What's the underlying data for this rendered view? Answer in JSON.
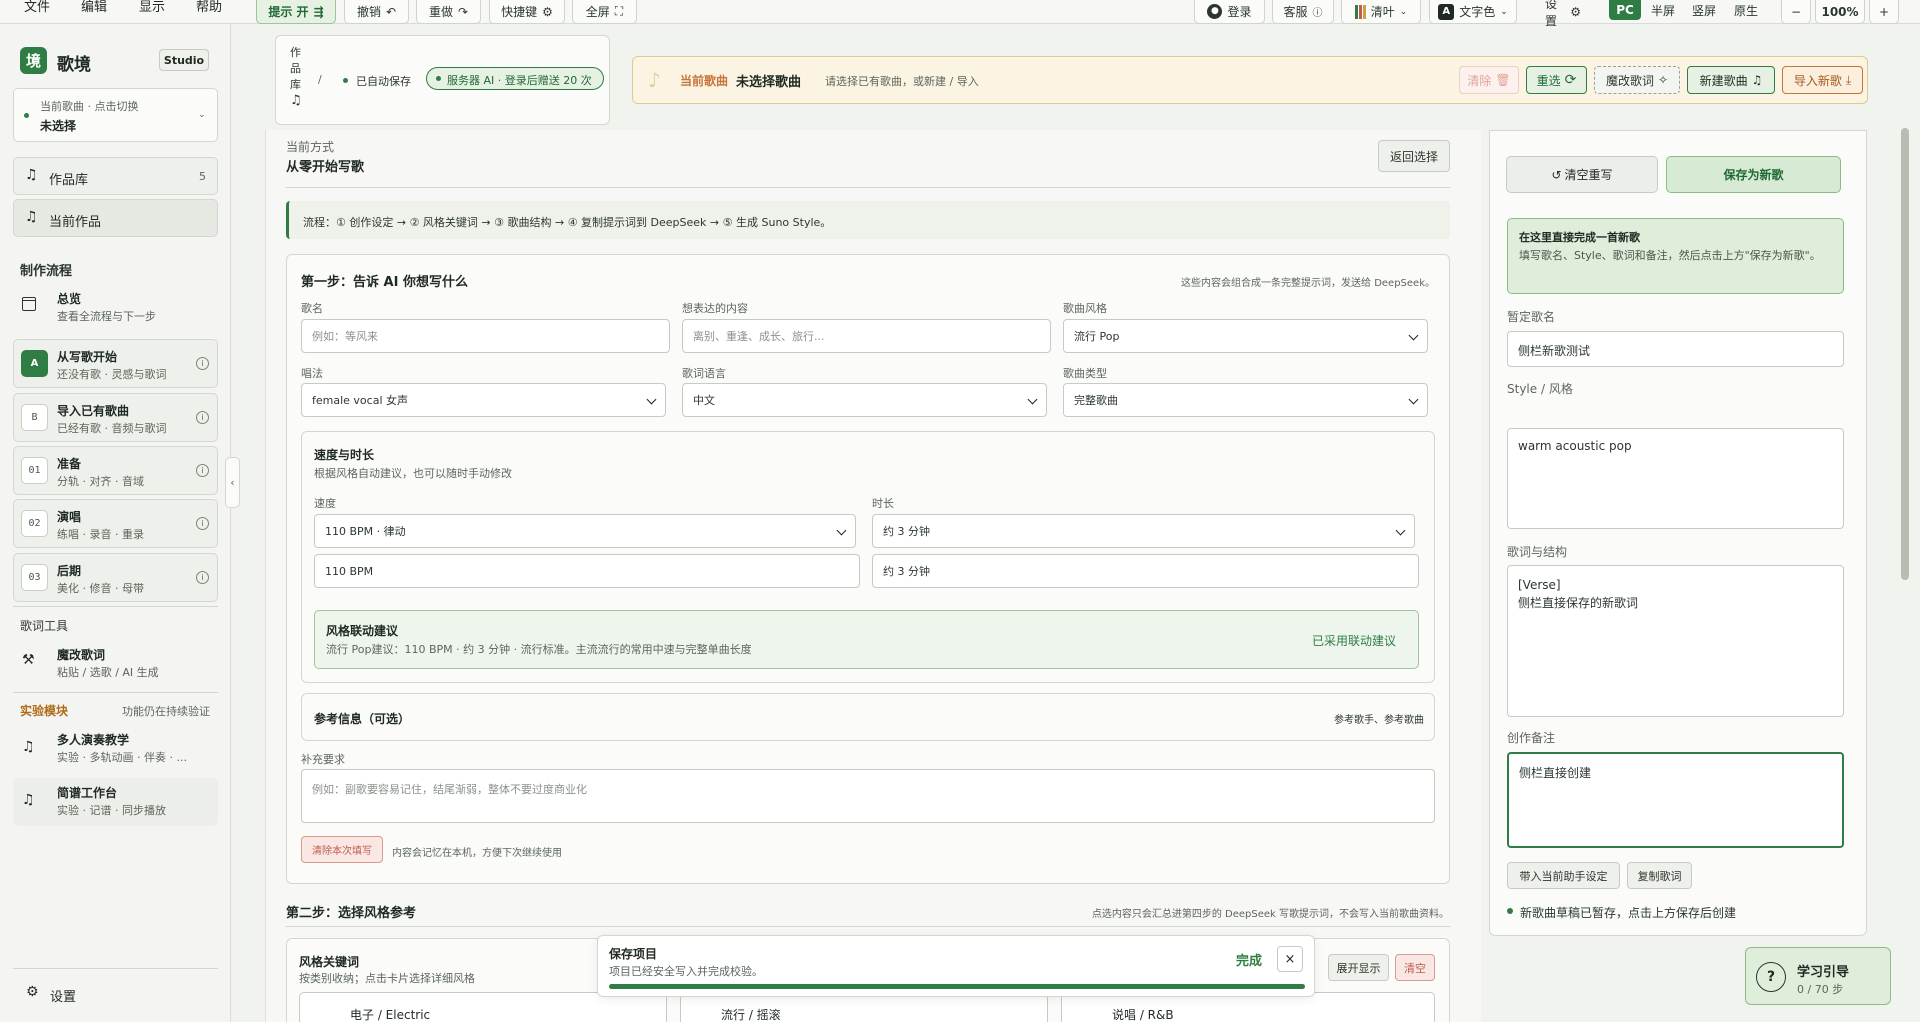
{
  "colors": {
    "accent": "#2f7d44",
    "accent_light": "#e6f1e4",
    "warn": "#c8743a",
    "danger": "#c45a4e",
    "banner_bg": "#fbf4e3"
  },
  "menubar": {
    "file": "文件",
    "edit": "编辑",
    "view": "显示",
    "help": "帮助"
  },
  "toolbar": {
    "hint": "提示 开",
    "undo": "撤销",
    "redo": "重做",
    "shortcut": "快捷键",
    "fullscreen": "全屏",
    "login": "登录",
    "support": "客服",
    "theme": "清叶",
    "text_color": "文字色",
    "settings": "设置",
    "layout_modes": [
      "PC",
      "半屏",
      "竖屏",
      "原生"
    ],
    "zoom_out": "−",
    "zoom": "100%",
    "zoom_in": "+"
  },
  "sidebar": {
    "brand": "歌境",
    "brand_logo": "境",
    "studio": "Studio",
    "current_song_hint": "当前歌曲 · 点击切换",
    "current_song_value": "未选择",
    "library": "作品库",
    "library_count": "5",
    "current_work": "当前作品",
    "workflow_heading": "制作流程",
    "overview_title": "总览",
    "overview_sub": "查看全流程与下一步",
    "steps": [
      {
        "badge": "A",
        "title": "从写歌开始",
        "sub": "还没有歌 · 灵感与歌词"
      },
      {
        "badge": "B",
        "title": "导入已有歌曲",
        "sub": "已经有歌 · 音频与歌词"
      },
      {
        "badge": "01",
        "title": "准备",
        "sub": "分轨 · 对齐 · 音域"
      },
      {
        "badge": "02",
        "title": "演唱",
        "sub": "练唱 · 录音 · 重录"
      },
      {
        "badge": "03",
        "title": "后期",
        "sub": "美化 · 修音 · 母带"
      }
    ],
    "lyric_tools_heading": "歌词工具",
    "lyric_edit_title": "魔改歌词",
    "lyric_edit_sub": "粘贴 / 选歌 / AI 生成",
    "lab_heading": "实验模块",
    "lab_note": "功能仍在持续验证",
    "lab_items": [
      {
        "title": "多人演奏教学",
        "sub": "实验 · 多轨动画 · 伴奏 · ..."
      },
      {
        "title": "简谱工作台",
        "sub": "实验 · 记谱 · 同步播放"
      }
    ],
    "settings": "设置"
  },
  "header_card": {
    "breadcrumb_chars": [
      "作",
      "品",
      "库"
    ],
    "separator": "/",
    "autosave": "已自动保存",
    "server": "服务器 AI · 登录后赠送 20 次"
  },
  "banner": {
    "label": "当前歌曲",
    "value": "未选择歌曲",
    "hint": "请选择已有歌曲，或新建 / 导入",
    "clear": "清除",
    "reselect": "重选",
    "edit_lyrics": "魔改歌词",
    "new_song": "新建歌曲",
    "import_new": "导入新歌"
  },
  "main": {
    "mode_label": "当前方式",
    "mode_value": "从零开始写歌",
    "back": "返回选择",
    "flow": "流程：① 创作设定 → ② 风格关键词 → ③ 歌曲结构 → ④ 复制提示词到 DeepSeek → ⑤ 生成 Suno Style。",
    "step1_title": "第一步：告诉 AI 你想写什么",
    "step1_note": "这些内容会组合成一条完整提示词，发送给 DeepSeek。",
    "song_name_label": "歌名",
    "song_name_ph": "例如：等风来",
    "content_label": "想表达的内容",
    "content_ph": "离别、重逢、成长、旅行...",
    "style_label": "歌曲风格",
    "style_value": "流行 Pop",
    "vocal_label": "唱法",
    "vocal_value": "female vocal 女声",
    "lang_label": "歌词语言",
    "lang_value": "中文",
    "type_label": "歌曲类型",
    "type_value": "完整歌曲",
    "tempo_title": "速度与时长",
    "tempo_sub": "根据风格自动建议，也可以随时手动修改",
    "speed_label": "速度",
    "speed_select": "110 BPM · 律动",
    "speed_value": "110 BPM",
    "duration_label": "时长",
    "duration_select": "约 3 分钟",
    "duration_value": "约 3 分钟",
    "suggest_title": "风格联动建议",
    "suggest_text": "流行 Pop建议：110 BPM · 约 3 分钟 · 流行标准。主流流行的常用中速与完整单曲长度",
    "suggest_status": "已采用联动建议",
    "ref_title": "参考信息（可选）",
    "ref_note": "参考歌手、参考歌曲",
    "extra_label": "补充要求",
    "extra_ph": "例如：副歌要容易记住，结尾渐弱，整体不要过度商业化",
    "clear_btn": "清除本次填写",
    "clear_note": "内容会记忆在本机，方便下次继续使用",
    "step2_title": "第二步：选择风格参考",
    "step2_note": "点选内容只会汇总进第四步的 DeepSeek 写歌提示词，不会写入当前歌曲资料。",
    "kw_title": "风格关键词",
    "kw_sub": "按类别收纳；点击卡片选择详细风格",
    "expand": "展开显示",
    "clear_kw": "清空",
    "genres": [
      "电子 / Electric",
      "流行 / 摇滚",
      "说唱 / R&B"
    ]
  },
  "right": {
    "reset": "清空重写",
    "save_new": "保存为新歌",
    "info_title": "在这里直接完成一首新歌",
    "info_text": "填写歌名、Style、歌词和备注，然后点击上方\"保存为新歌\"。",
    "name_label": "暂定歌名",
    "name_value": "侧栏新歌测试",
    "style_label": "Style / 风格",
    "style_value": "warm acoustic pop",
    "lyrics_label": "歌词与结构",
    "lyrics_line1": "[Verse]",
    "lyrics_line2": "侧栏直接保存的新歌词",
    "notes_label": "创作备注",
    "notes_value": "侧栏直接创建",
    "bring_assistant": "带入当前助手设定",
    "copy_lyrics": "复制歌词",
    "status": "新歌曲草稿已暂存，点击上方保存后创建"
  },
  "toast": {
    "title": "保存项目",
    "sub": "项目已经安全写入并完成校验。",
    "done": "完成",
    "close": "×",
    "progress": 1.0
  },
  "guide": {
    "title": "学习引导",
    "progress": "0 / 70 步",
    "icon": "?"
  }
}
